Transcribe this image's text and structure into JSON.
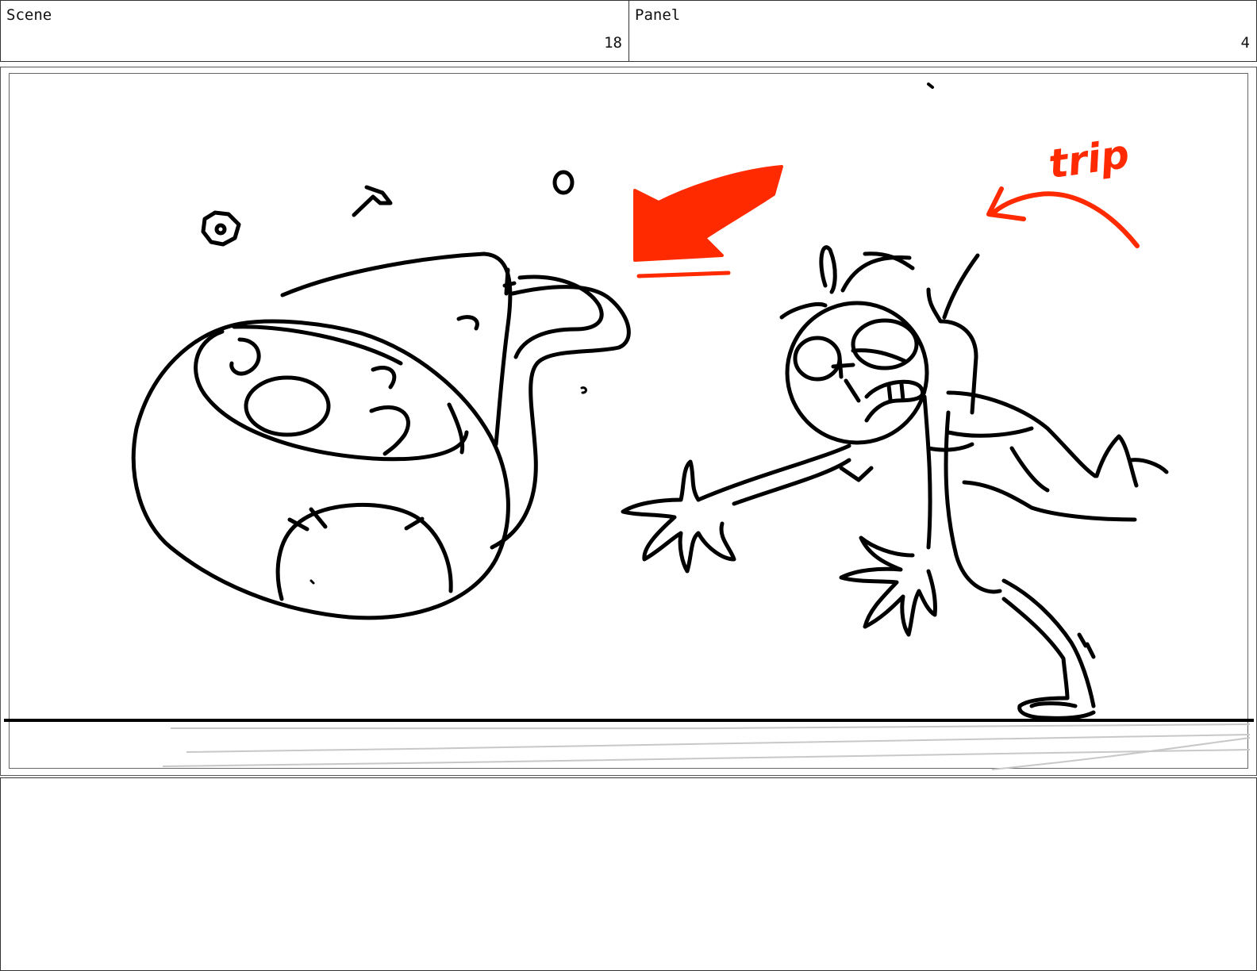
{
  "header": {
    "scene_label": "Scene",
    "scene_number": "18",
    "panel_label": "Panel",
    "panel_number": "4"
  },
  "sketch": {
    "annotation_text": "trip",
    "annotation_color": "#ff2a00",
    "line_color": "#000000",
    "ground_smear_color": "#c8c8c8"
  },
  "notes": {
    "text": ""
  }
}
